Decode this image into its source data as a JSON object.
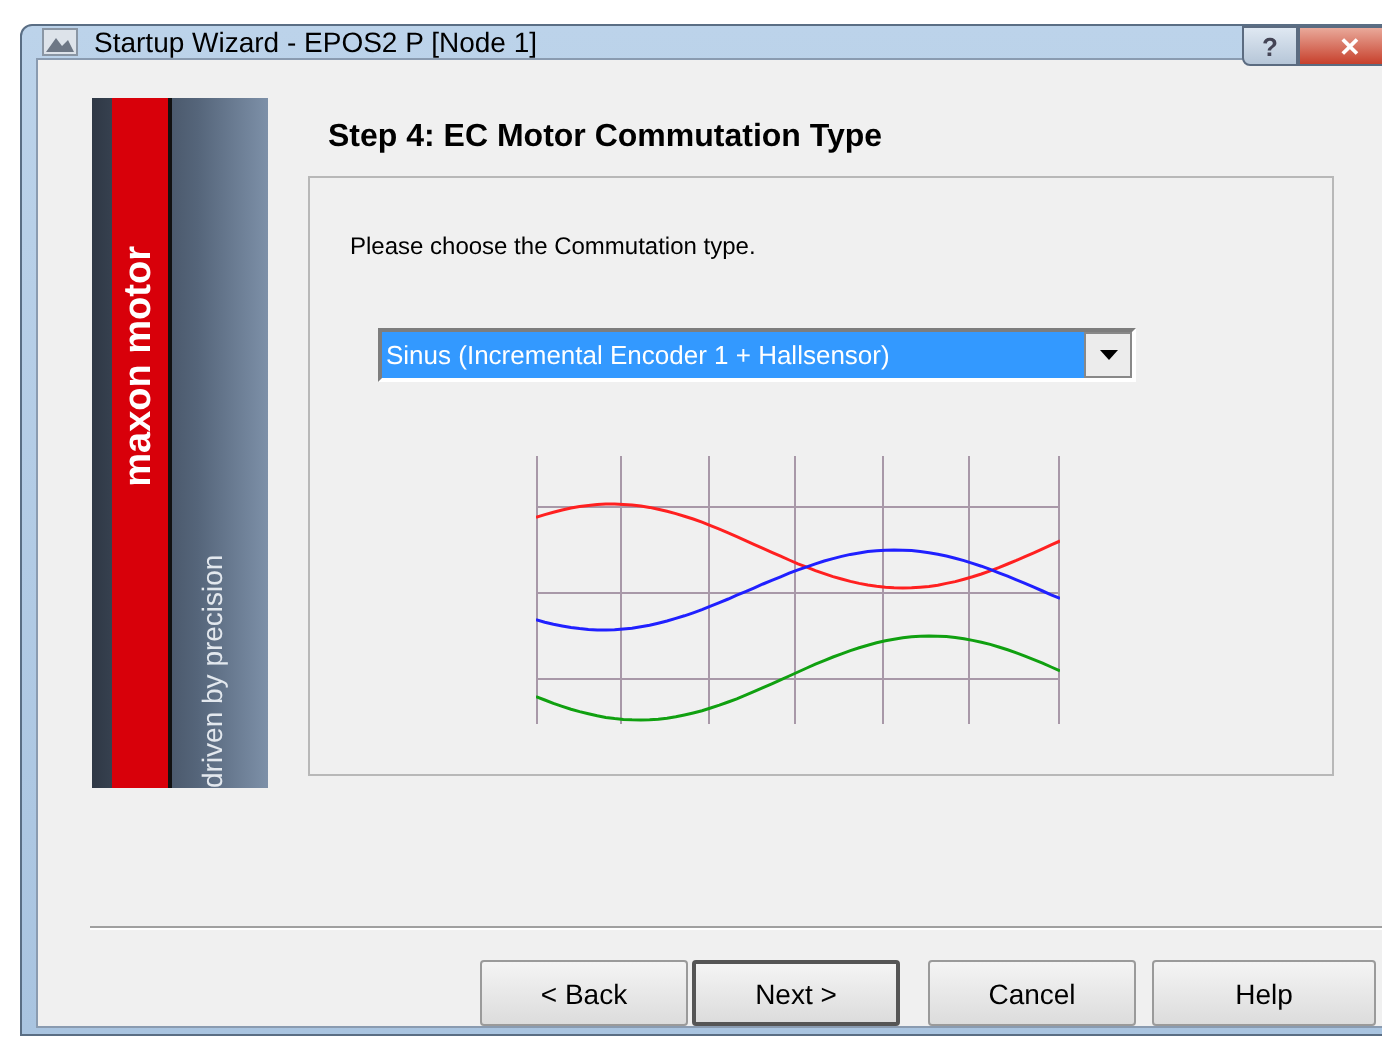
{
  "window": {
    "title": "Startup Wizard - EPOS2 P [Node 1]",
    "help_glyph": "?",
    "close_glyph": "✕"
  },
  "banner": {
    "brand": "maxon motor",
    "slogan": "driven by precision"
  },
  "step_title": "Step 4: EC Motor Commutation Type",
  "prompt": "Please choose the Commutation type.",
  "commutation": {
    "value": "Sinus (Incremental Encoder 1 + Hallsensor)"
  },
  "buttons": [
    {
      "label": "< Back",
      "default": false
    },
    {
      "label": "Next >",
      "default": true
    },
    {
      "label": "Cancel",
      "default": false
    },
    {
      "label": "Help",
      "default": false
    }
  ]
}
